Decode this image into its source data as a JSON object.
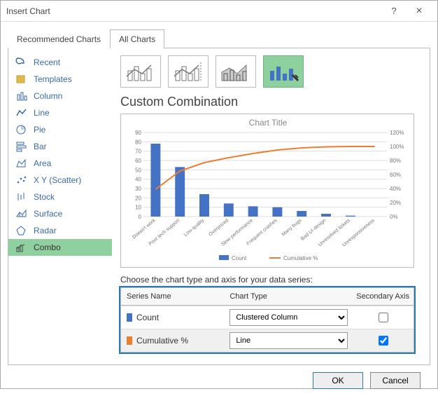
{
  "titlebar": {
    "title": "Insert Chart",
    "help": "?",
    "close": "×"
  },
  "tabs": {
    "recommended": "Recommended Charts",
    "all": "All Charts"
  },
  "sidebar": {
    "items": [
      {
        "label": "Recent"
      },
      {
        "label": "Templates"
      },
      {
        "label": "Column"
      },
      {
        "label": "Line"
      },
      {
        "label": "Pie"
      },
      {
        "label": "Bar"
      },
      {
        "label": "Area"
      },
      {
        "label": "X Y (Scatter)"
      },
      {
        "label": "Stock"
      },
      {
        "label": "Surface"
      },
      {
        "label": "Radar"
      },
      {
        "label": "Combo"
      }
    ]
  },
  "type_thumbs": [
    "clustered-column-line",
    "clustered-column-line-secondary",
    "stacked-area-column",
    "custom-combination"
  ],
  "section_title": "Custom Combination",
  "chart_data": {
    "type": "combo",
    "title": "Chart Title",
    "xlabel": "",
    "categories": [
      "Doesn't work",
      "Poor tech support",
      "Low quality",
      "Overpriced",
      "Slow performance",
      "Frequent crashes",
      "Many bugs",
      "Bad UI design",
      "Unresolved tickets",
      "Unresponsiveness"
    ],
    "series": [
      {
        "name": "Count",
        "type": "bar",
        "axis": "primary",
        "values": [
          78,
          53,
          24,
          14,
          11,
          10,
          6,
          3,
          1,
          0
        ]
      },
      {
        "name": "Cumulative %",
        "type": "line",
        "axis": "secondary",
        "values": [
          39,
          65,
          77,
          84,
          90,
          95,
          98,
          99.5,
          100,
          100
        ]
      }
    ],
    "y_primary": {
      "min": 0,
      "max": 90,
      "ticks": [
        0,
        10,
        20,
        30,
        40,
        50,
        60,
        70,
        80,
        90
      ],
      "label": ""
    },
    "y_secondary": {
      "min": 0,
      "max": 120,
      "ticks_pct": [
        0,
        20,
        40,
        60,
        80,
        100,
        120
      ],
      "label": "",
      "suffix": "%"
    },
    "legend": [
      "Count",
      "Cumulative %"
    ]
  },
  "series_config": {
    "instructions": "Choose the chart type and axis for your data series:",
    "headers": {
      "name": "Series Name",
      "type": "Chart Type",
      "secondary": "Secondary Axis"
    },
    "rows": [
      {
        "name": "Count",
        "color": "blue",
        "chart_type": "Clustered Column",
        "secondary": false
      },
      {
        "name": "Cumulative %",
        "color": "orange",
        "chart_type": "Line",
        "secondary": true
      }
    ]
  },
  "buttons": {
    "ok": "OK",
    "cancel": "Cancel"
  }
}
